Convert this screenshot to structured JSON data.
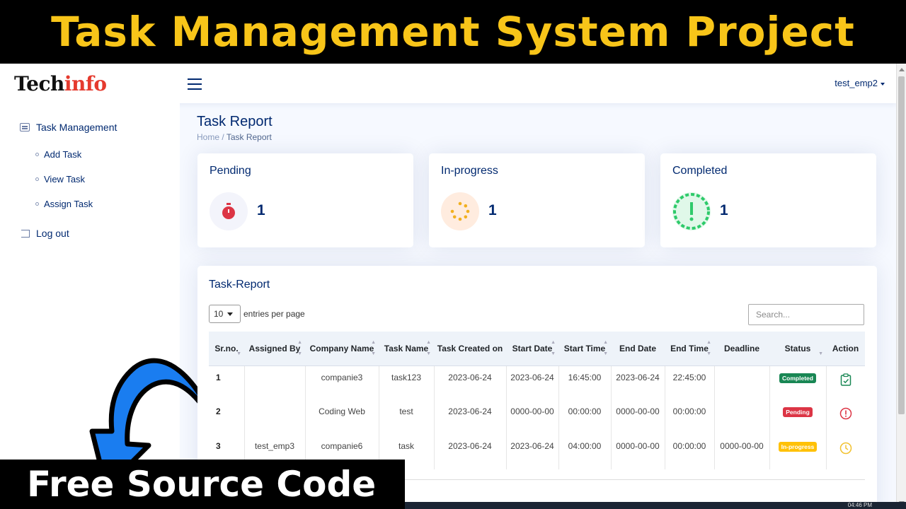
{
  "banner": {
    "title": "Task Management System Project"
  },
  "overlay": {
    "free_text": "Free Source Code"
  },
  "header": {
    "logo_part1": "Tech",
    "logo_part2": "info",
    "user": "test_emp2"
  },
  "sidebar": {
    "heading": "Task Management",
    "items": [
      {
        "label": "Add Task"
      },
      {
        "label": "View Task"
      },
      {
        "label": "Assign Task"
      }
    ],
    "logout": "Log out"
  },
  "page": {
    "title": "Task Report",
    "breadcrumb_home": "Home",
    "breadcrumb_sep": "/",
    "breadcrumb_current": "Task Report"
  },
  "stats": [
    {
      "label": "Pending",
      "count": "1",
      "icon": "stopwatch-icon",
      "color": "#dc3545"
    },
    {
      "label": "In-progress",
      "count": "1",
      "icon": "loading-dots-icon",
      "color": "#f2b01e"
    },
    {
      "label": "Completed",
      "count": "1",
      "icon": "exclamation-circle-icon",
      "color": "#2eca6a"
    }
  ],
  "report": {
    "title": "Task-Report",
    "entries_value": "10",
    "entries_label": "entries per page",
    "search_placeholder": "Search...",
    "columns": [
      "Sr.no.",
      "Assigned By",
      "Company Name",
      "Task Name",
      "Task Created on",
      "Start Date",
      "Start Time",
      "End Date",
      "End Time",
      "Deadline",
      "Status",
      "Action"
    ],
    "rows": [
      {
        "sr": "1",
        "assigned_by": "",
        "company": "companie3",
        "task": "task123",
        "created": "2023-06-24",
        "start_date": "2023-06-24",
        "start_time": "16:45:00",
        "end_date": "2023-06-24",
        "end_time": "22:45:00",
        "deadline": "",
        "status": "Completed",
        "status_color": "#198754",
        "action_icon": "clipboard-check-icon"
      },
      {
        "sr": "2",
        "assigned_by": "",
        "company": "Coding Web",
        "task": "test",
        "created": "2023-06-24",
        "start_date": "0000-00-00",
        "start_time": "00:00:00",
        "end_date": "0000-00-00",
        "end_time": "00:00:00",
        "deadline": "",
        "status": "Pending",
        "status_color": "#dc3545",
        "action_icon": "exclamation-circle-icon"
      },
      {
        "sr": "3",
        "assigned_by": "test_emp3",
        "company": "companie6",
        "task": "task",
        "created": "2023-06-24",
        "start_date": "2023-06-24",
        "start_time": "04:00:00",
        "end_date": "0000-00-00",
        "end_time": "00:00:00",
        "deadline": "0000-00-00",
        "status": "In-progress",
        "status_color": "#ffc107",
        "action_icon": "clock-icon"
      }
    ]
  },
  "taskbar": {
    "time": "04:46 PM"
  }
}
